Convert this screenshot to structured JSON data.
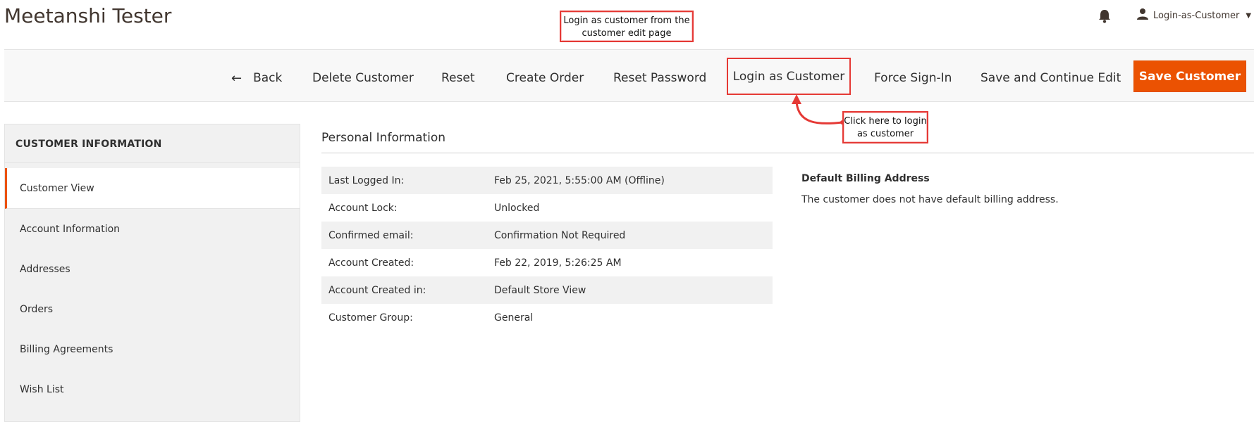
{
  "header": {
    "title": "Meetanshi Tester",
    "user_name": "Login-as-Customer",
    "icons": {
      "notifications": "bell-icon",
      "user": "user-icon",
      "dropdown": "caret-down-icon"
    }
  },
  "annotations": {
    "top_note": "Login as customer from the customer edit page",
    "side_note": "Click here to login as customer"
  },
  "toolbar": {
    "back_label": "Back",
    "delete_label": "Delete Customer",
    "reset_label": "Reset",
    "create_order_label": "Create Order",
    "reset_password_label": "Reset Password",
    "login_as_customer_label": "Login as Customer",
    "force_sign_in_label": "Force Sign-In",
    "save_continue_label": "Save and Continue Edit",
    "save_label": "Save Customer",
    "accent_color": "#eb5202"
  },
  "sidebar": {
    "title": "CUSTOMER INFORMATION",
    "items": [
      {
        "label": "Customer View",
        "active": true
      },
      {
        "label": "Account Information"
      },
      {
        "label": "Addresses"
      },
      {
        "label": "Orders"
      },
      {
        "label": "Billing Agreements"
      },
      {
        "label": "Wish List"
      }
    ]
  },
  "main": {
    "section_title": "Personal Information",
    "rows": [
      {
        "label": "Last Logged In:",
        "value": "Feb 25, 2021, 5:55:00 AM (Offline)"
      },
      {
        "label": "Account Lock:",
        "value": "Unlocked"
      },
      {
        "label": "Confirmed email:",
        "value": "Confirmation Not Required"
      },
      {
        "label": "Account Created:",
        "value": "Feb 22, 2019, 5:26:25 AM"
      },
      {
        "label": "Account Created in:",
        "value": "Default Store View"
      },
      {
        "label": "Customer Group:",
        "value": "General"
      }
    ],
    "billing": {
      "title": "Default Billing Address",
      "text": "The customer does not have default billing address."
    }
  }
}
